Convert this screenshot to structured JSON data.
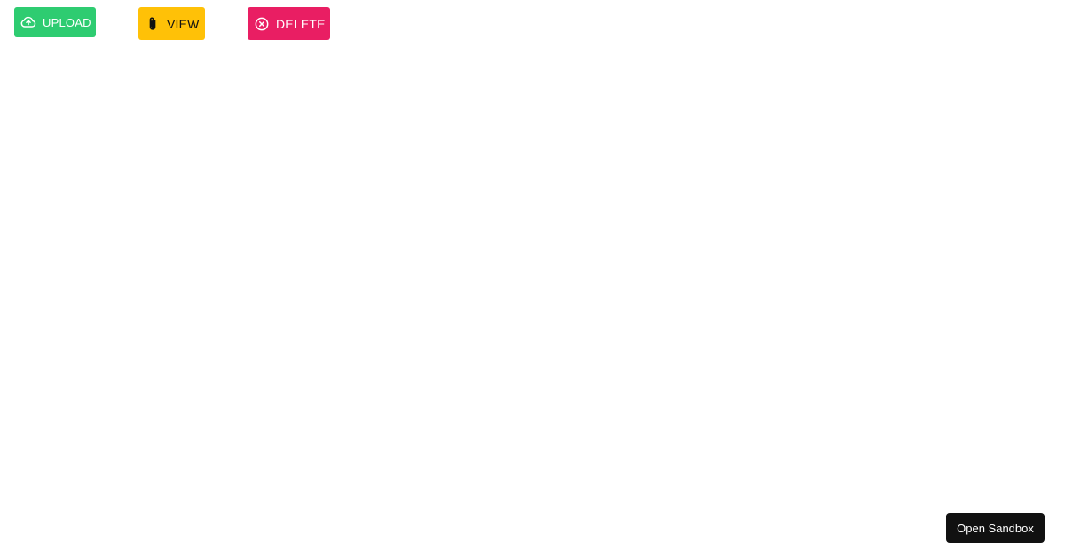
{
  "toolbar": {
    "upload": {
      "label": "UPLOAD",
      "icon": "cloud-upload-icon",
      "color": "#2ecc71"
    },
    "view": {
      "label": "VIEW",
      "icon": "paperclip-icon",
      "color": "#ffc107"
    },
    "delete": {
      "label": "DELETE",
      "icon": "cancel-circle-icon",
      "color": "#e91e63"
    }
  },
  "sandbox": {
    "label": "Open Sandbox",
    "color": "#111111"
  }
}
